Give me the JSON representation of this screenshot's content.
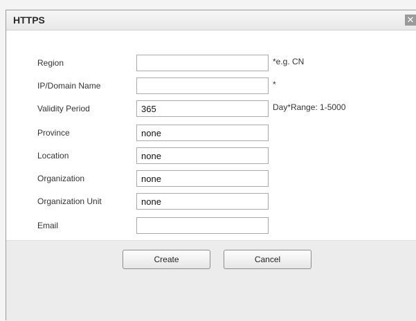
{
  "dialog": {
    "title": "HTTPS",
    "close_icon": "close-icon"
  },
  "fields": [
    {
      "label": "Region",
      "value": "",
      "hint": "*e.g. CN"
    },
    {
      "label": "IP/Domain Name",
      "value": "",
      "hint": "*"
    },
    {
      "label": "Validity Period",
      "value": "365",
      "hint": "Day*Range: 1-5000"
    },
    {
      "label": "Province",
      "value": "none",
      "hint": ""
    },
    {
      "label": "Location",
      "value": "none",
      "hint": ""
    },
    {
      "label": "Organization",
      "value": "none",
      "hint": ""
    },
    {
      "label": "Organization Unit",
      "value": "none",
      "hint": ""
    },
    {
      "label": "Email",
      "value": "",
      "hint": ""
    }
  ],
  "buttons": {
    "create": "Create",
    "cancel": "Cancel"
  }
}
